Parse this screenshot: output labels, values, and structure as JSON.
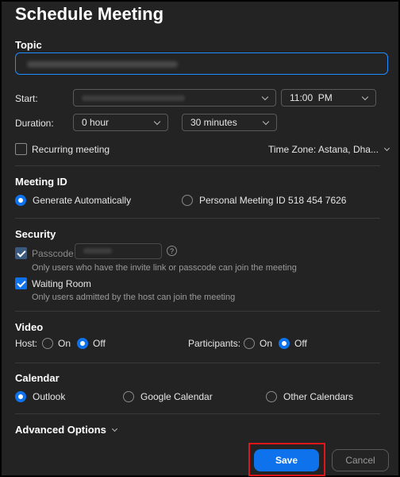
{
  "title": "Schedule Meeting",
  "topic": {
    "label": "Topic",
    "value": ""
  },
  "start": {
    "label": "Start:",
    "date_value": "",
    "time_value": "11:00  PM"
  },
  "duration": {
    "label": "Duration:",
    "hours": "0 hour",
    "minutes": "30 minutes"
  },
  "recurring": {
    "label": "Recurring meeting",
    "checked": false
  },
  "timezone": {
    "label": "Time Zone: Astana, Dha..."
  },
  "meeting_id": {
    "heading": "Meeting ID",
    "generate": "Generate Automatically",
    "personal": "Personal Meeting ID 518 454 7626"
  },
  "security": {
    "heading": "Security",
    "passcode_label": "Passcode",
    "passcode_help": "Only users who have the invite link or passcode can join the meeting",
    "waiting_room_label": "Waiting Room",
    "waiting_room_help": "Only users admitted by the host can join the meeting"
  },
  "video": {
    "heading": "Video",
    "host_label": "Host:",
    "participants_label": "Participants:",
    "on": "On",
    "off": "Off"
  },
  "calendar": {
    "heading": "Calendar",
    "outlook": "Outlook",
    "google": "Google Calendar",
    "other": "Other Calendars"
  },
  "advanced": {
    "label": "Advanced Options"
  },
  "buttons": {
    "save": "Save",
    "cancel": "Cancel"
  },
  "colors": {
    "accent": "#0e72ed",
    "highlight_outline": "#e0141b"
  }
}
